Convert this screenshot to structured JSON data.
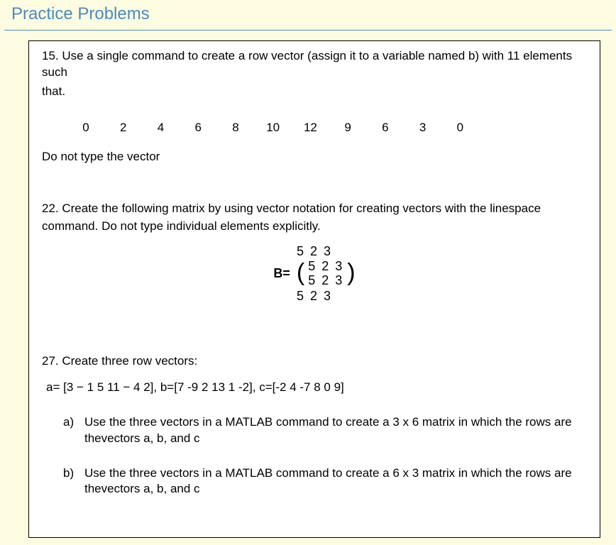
{
  "title": "Practice Problems",
  "q15": {
    "stem1": "15. Use a single command to create a row vector (assign it to a variable named b) with 11 elements such",
    "stem2": "that.",
    "vector": [
      "0",
      "2",
      "4",
      "6",
      "8",
      "10",
      "12",
      "9",
      "6",
      "3",
      "0"
    ],
    "note": "Do not type the vector"
  },
  "q22": {
    "stem1": "22. Create the following matrix by using vector notation for creating vectors with the linespace",
    "stem2": "command. Do not type individual elements explicitly.",
    "label": "B=",
    "top": "5 2 3",
    "row1": "5 2 3",
    "row2": "5 2 3",
    "bottom": "5 2 3"
  },
  "q27": {
    "stem": "27. Create three row vectors:",
    "vectors": "a= [3  − 1  5  11  − 4   2],   b=[7  -9  2  13  1  -2],    c=[-2  4  -7  8  0  9]",
    "a_letter": "a)",
    "a_text": "Use the three vectors in a MATLAB command to create a 3 x 6 matrix in which the rows are thevectors  a, b, and c",
    "b_letter": "b)",
    "b_text": "Use the three vectors in a MATLAB command to create a 6 x 3 matrix in which the rows are thevectors  a, b, and c"
  }
}
